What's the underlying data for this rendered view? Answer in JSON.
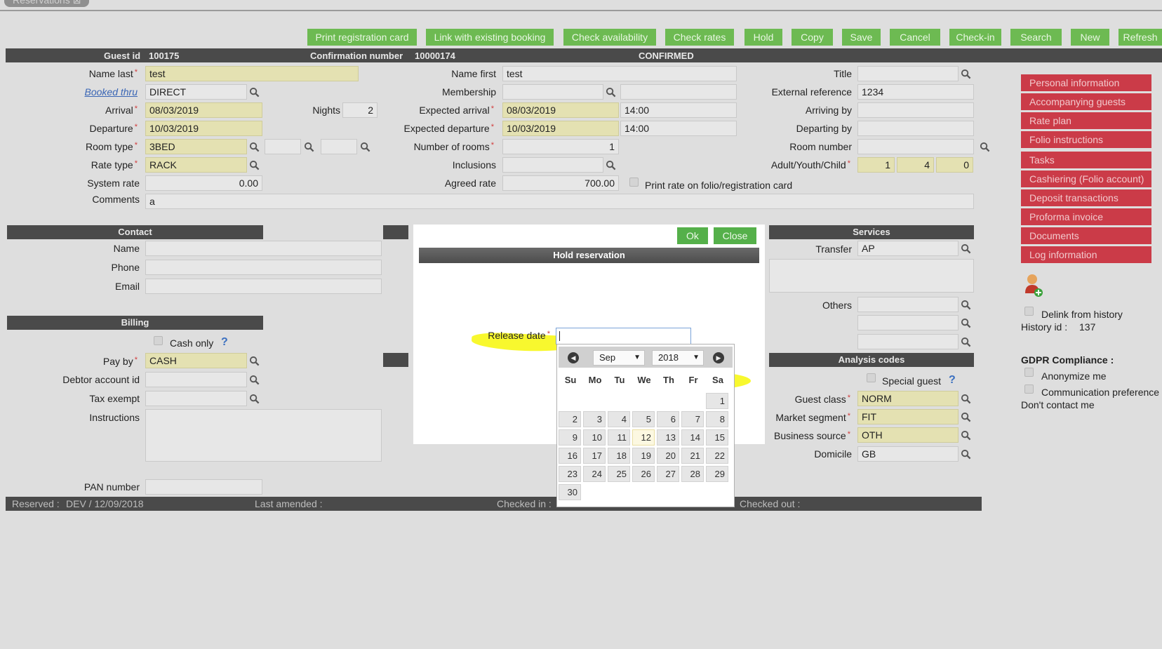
{
  "window": {
    "tab_label": "Reservations"
  },
  "toolbar": {
    "buttons": [
      "Print registration card",
      "Link with existing booking",
      "Check availability",
      "Check rates",
      "Hold",
      "Copy",
      "Save",
      "Cancel",
      "Check-in",
      "Search",
      "New",
      "Refresh"
    ]
  },
  "header": {
    "guest_id_label": "Guest id",
    "guest_id": "100175",
    "confirmation_label": "Confirmation number",
    "confirmation_number": "10000174",
    "status": "CONFIRMED"
  },
  "form": {
    "name_last": {
      "label": "Name last",
      "value": "test"
    },
    "booked_thru": {
      "label": "Booked thru",
      "value": "DIRECT"
    },
    "arrival": {
      "label": "Arrival",
      "value": "08/03/2019"
    },
    "departure": {
      "label": "Departure",
      "value": "10/03/2019"
    },
    "nights": {
      "label": "Nights",
      "value": "2"
    },
    "room_type": {
      "label": "Room type",
      "value": "3BED"
    },
    "rate_type": {
      "label": "Rate type",
      "value": "RACK"
    },
    "system_rate": {
      "label": "System rate",
      "value": "0.00"
    },
    "comments": {
      "label": "Comments",
      "value": "a"
    },
    "name_first": {
      "label": "Name first",
      "value": "test"
    },
    "membership": {
      "label": "Membership",
      "value": ""
    },
    "expected_arrival": {
      "label": "Expected arrival",
      "date": "08/03/2019",
      "time": "14:00"
    },
    "expected_departure": {
      "label": "Expected departure",
      "date": "10/03/2019",
      "time": "14:00"
    },
    "number_of_rooms": {
      "label": "Number of rooms",
      "value": "1"
    },
    "inclusions": {
      "label": "Inclusions",
      "value": ""
    },
    "agreed_rate": {
      "label": "Agreed rate",
      "value": "700.00"
    },
    "print_rate_label": "Print rate on folio/registration card",
    "title": {
      "label": "Title",
      "value": ""
    },
    "external_reference": {
      "label": "External reference",
      "value": "1234"
    },
    "arriving_by": {
      "label": "Arriving by",
      "value": ""
    },
    "departing_by": {
      "label": "Departing by",
      "value": ""
    },
    "room_number": {
      "label": "Room number",
      "value": ""
    },
    "adult_youth_child": {
      "label": "Adult/Youth/Child",
      "adult": "1",
      "youth": "4",
      "child": "0"
    }
  },
  "contact": {
    "title": "Contact",
    "name_label": "Name",
    "phone_label": "Phone",
    "email_label": "Email"
  },
  "billing": {
    "title": "Billing",
    "cash_only_label": "Cash only",
    "pay_by_label": "Pay by",
    "pay_by": "CASH",
    "debtor_label": "Debtor account id",
    "tax_exempt_label": "Tax exempt",
    "instructions_label": "Instructions",
    "pan_label": "PAN number"
  },
  "services": {
    "title": "Services",
    "transfer_label": "Transfer",
    "transfer": "AP",
    "others_label": "Others"
  },
  "analysis": {
    "title": "Analysis codes",
    "special_guest_label": "Special guest",
    "guest_class_label": "Guest class",
    "guest_class": "NORM",
    "market_segment_label": "Market segment",
    "market_segment": "FIT",
    "business_source_label": "Business source",
    "business_source": "OTH",
    "domicile_label": "Domicile",
    "domicile": "GB"
  },
  "sidebar": {
    "items": [
      "Personal information",
      "Accompanying guests",
      "Rate plan",
      "Folio instructions",
      "Tasks",
      "Cashiering (Folio account)",
      "Deposit transactions",
      "Proforma invoice",
      "Documents",
      "Log information"
    ]
  },
  "history": {
    "delink_label": "Delink from history",
    "history_id_label": "History id :",
    "history_id": "137"
  },
  "gdpr": {
    "title": "GDPR Compliance :",
    "anonymize_label": "Anonymize me",
    "comm_label": "Communication preference :",
    "comm_value": "Don't contact me"
  },
  "footer": {
    "reserved_label": "Reserved :",
    "reserved_value": "DEV / 12/09/2018",
    "last_amended_label": "Last amended :",
    "checked_in_label": "Checked in :",
    "checked_out_label": "Checked out :"
  },
  "modal": {
    "title": "Hold reservation",
    "ok_label": "Ok",
    "close_label": "Close",
    "release_date_label": "Release date",
    "release_date_value": ""
  },
  "calendar": {
    "month": "Sep",
    "year": "2018",
    "weekdays": [
      "Su",
      "Mo",
      "Tu",
      "We",
      "Th",
      "Fr",
      "Sa"
    ],
    "first_weekday_index": 6,
    "days_in_month": 30,
    "today": 12
  },
  "colors": {
    "toolbar_button": "#6dba52",
    "sidebar_button": "#cb3b48",
    "required_field": "#e4e1b2",
    "header_bar": "#4a4a4a",
    "highlight": "#f6f600"
  },
  "icons": {
    "lookup": "magnifier-icon",
    "prev": "prev-month-icon",
    "next": "next-month-icon",
    "add_guest": "add-user-icon",
    "help": "help-icon"
  }
}
